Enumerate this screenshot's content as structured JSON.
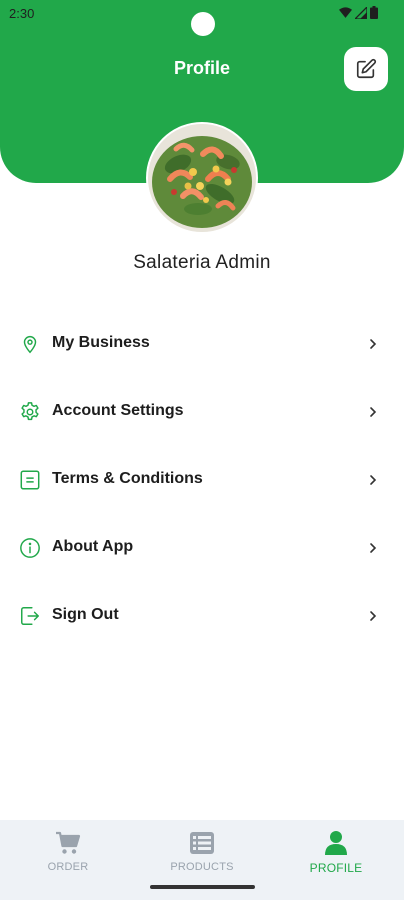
{
  "status_bar": {
    "time": "2:30"
  },
  "header": {
    "title": "Profile"
  },
  "profile": {
    "name": "Salateria Admin"
  },
  "menu": [
    {
      "label": "My Business",
      "icon": "location-pin-icon"
    },
    {
      "label": "Account Settings",
      "icon": "gear-icon"
    },
    {
      "label": "Terms & Conditions",
      "icon": "document-icon"
    },
    {
      "label": "About App",
      "icon": "info-icon"
    },
    {
      "label": "Sign Out",
      "icon": "sign-out-icon"
    }
  ],
  "bottom_nav": [
    {
      "label": "ORDER",
      "icon": "cart-icon",
      "active": false
    },
    {
      "label": "PRODUCTS",
      "icon": "list-icon",
      "active": false
    },
    {
      "label": "PROFILE",
      "icon": "person-icon",
      "active": true
    }
  ],
  "colors": {
    "brand": "#21a84a",
    "nav_inactive": "#9aa3ad",
    "nav_bg": "#eef2f6"
  }
}
